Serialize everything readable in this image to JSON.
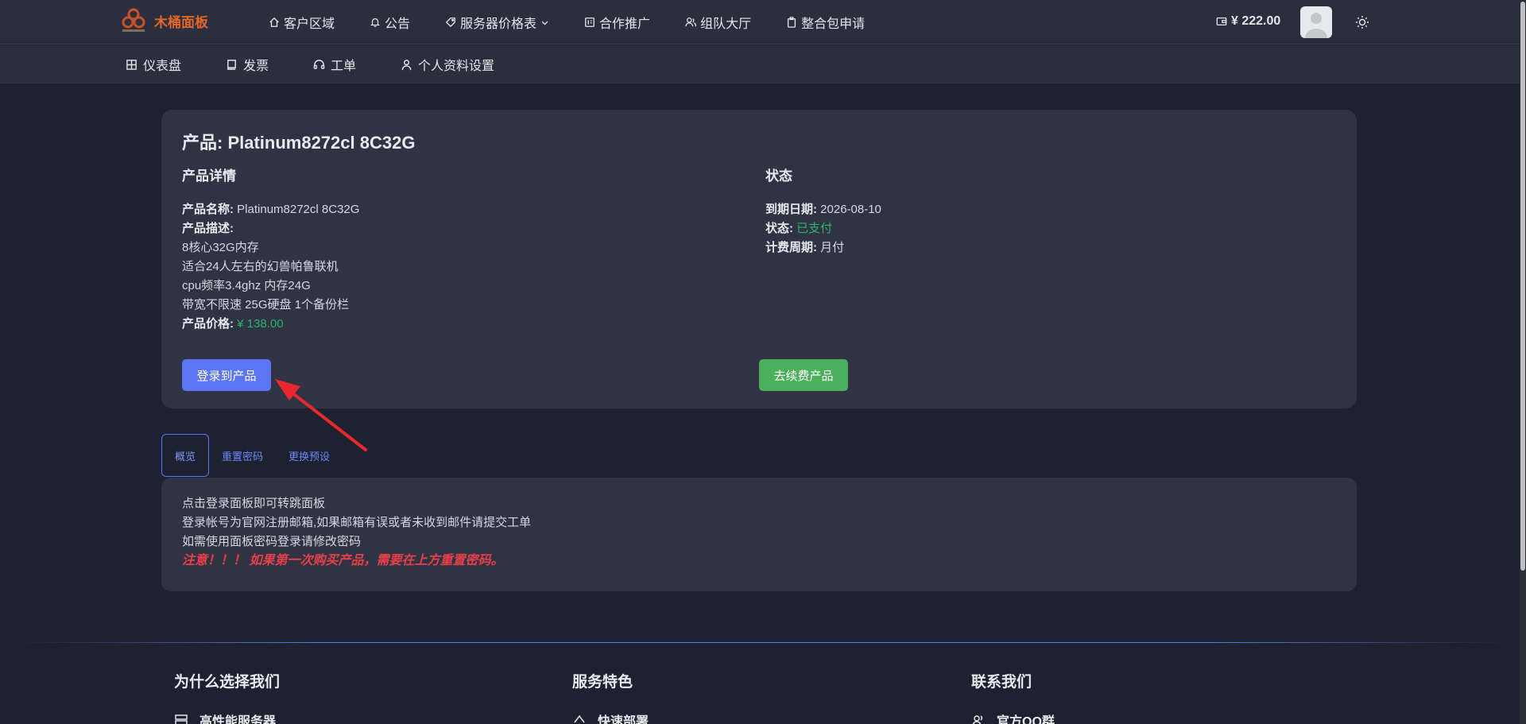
{
  "brand": {
    "name": "木桶面板"
  },
  "nav": {
    "items": [
      {
        "label": "客户区域",
        "icon": "home-icon"
      },
      {
        "label": "公告",
        "icon": "bell-icon"
      },
      {
        "label": "服务器价格表",
        "icon": "tag-icon"
      },
      {
        "label": "合作推广",
        "icon": "affiliate-icon"
      },
      {
        "label": "组队大厅",
        "icon": "users-icon"
      },
      {
        "label": "整合包申请",
        "icon": "clipboard-icon"
      }
    ],
    "balance": "¥ 222.00"
  },
  "subnav": {
    "items": [
      {
        "label": "仪表盘",
        "icon": "dashboard-icon"
      },
      {
        "label": "发票",
        "icon": "invoice-icon"
      },
      {
        "label": "工单",
        "icon": "headset-icon"
      },
      {
        "label": "个人资料设置",
        "icon": "user-icon"
      }
    ]
  },
  "product": {
    "title": "产品: Platinum8272cl 8C32G",
    "details_heading": "产品详情",
    "name_label": "产品名称:",
    "name_value": " Platinum8272cl 8C32G",
    "desc_label": "产品描述:",
    "desc_lines": [
      "8核心32G内存",
      "适合24人左右的幻兽帕鲁联机",
      "cpu频率3.4ghz 内存24G",
      "带宽不限速 25G硬盘 1个备份栏"
    ],
    "price_label": "产品价格:",
    "price_value": " ¥ 138.00",
    "status_heading": "状态",
    "expire_label": "到期日期:",
    "expire_value": " 2026-08-10",
    "status_label": "状态:",
    "status_value": " 已支付",
    "cycle_label": "计费周期:",
    "cycle_value": " 月付",
    "login_button": "登录到产品",
    "renew_button": "去续费产品"
  },
  "tabs": [
    "概览",
    "重置密码",
    "更换预设"
  ],
  "overview": {
    "lines": [
      "点击登录面板即可转跳面板",
      "登录帐号为官网注册邮箱,如果邮箱有误或者未收到邮件请提交工单",
      "如需使用面板密码登录请修改密码"
    ],
    "warning": "注意！！！ 如果第一次购买产品，需要在上方重置密码。"
  },
  "footer": {
    "why": {
      "heading": "为什么选择我们",
      "item": "高性能服务器"
    },
    "features": {
      "heading": "服务特色",
      "item": "快速部署"
    },
    "contact": {
      "heading": "联系我们",
      "item": "官方QQ群"
    }
  },
  "colors": {
    "accent": "#5b75f5",
    "success": "#4caf5c",
    "danger": "#e8404a",
    "brand": "#e0662a"
  }
}
